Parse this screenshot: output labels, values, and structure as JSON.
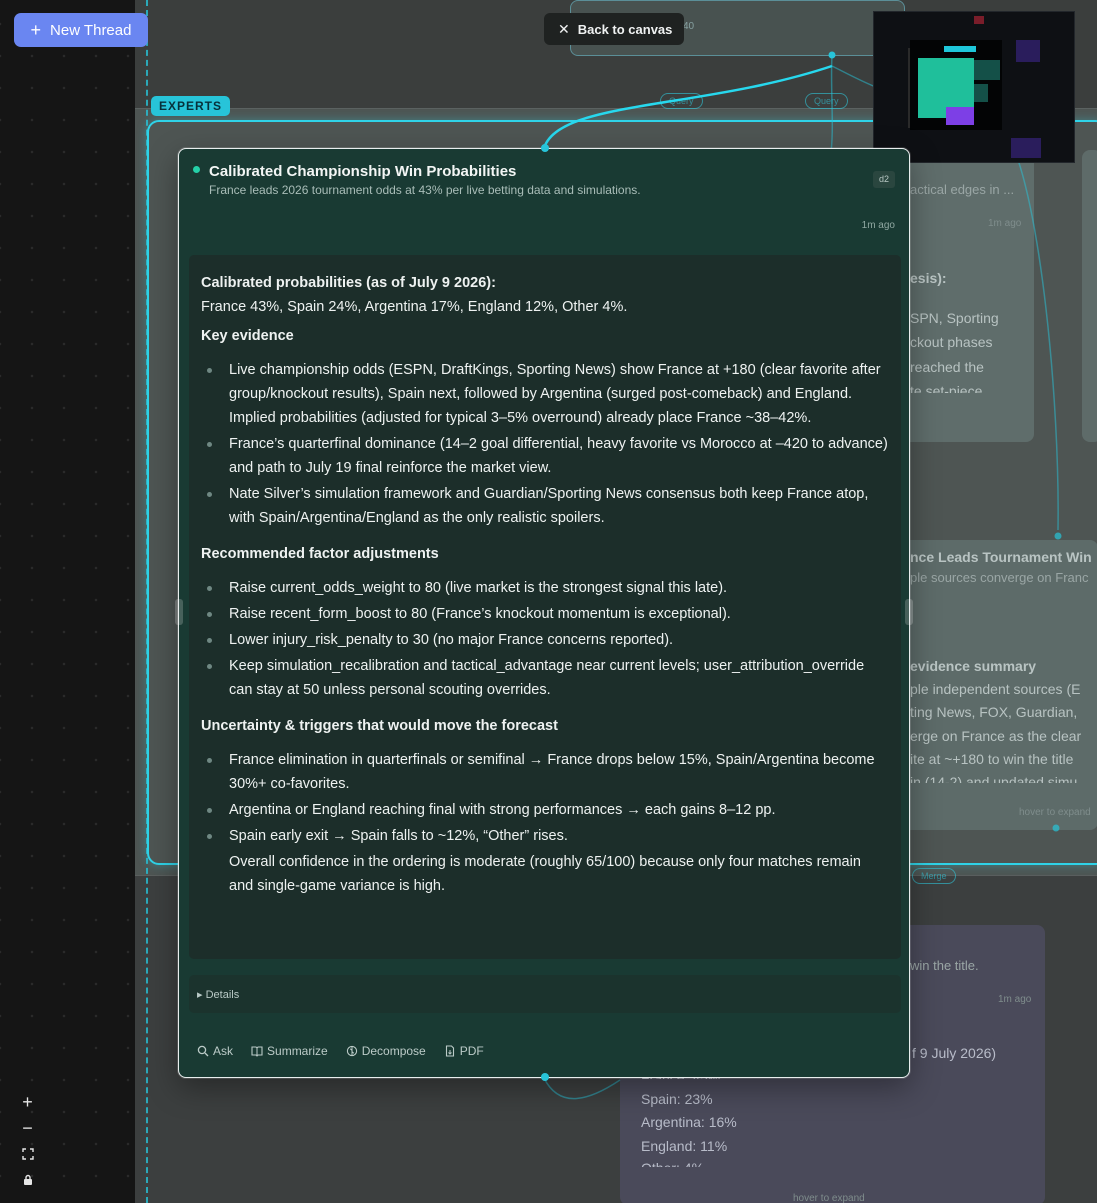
{
  "toolbar": {
    "new_thread_label": "New Thread",
    "back_to_canvas_label": "Back to canvas"
  },
  "group": {
    "tag": "EXPERTS"
  },
  "focused_card": {
    "title": "Calibrated Championship Win Probabilities",
    "subtitle": "France leads 2026 tournament odds at 43% per live betting data and simulations.",
    "badge": "d2",
    "time_ago": "1m ago",
    "heading1": "Calibrated probabilities (as of July 9 2026):",
    "probabilities_line": "France 43%, Spain 24%, Argentina 17%, England 12%, Other 4%.",
    "heading2": "Key evidence",
    "evidence": [
      "Live championship odds (ESPN, DraftKings, Sporting News) show France at +180 (clear favorite after group/knockout results), Spain next, followed by Argentina (surged post-comeback) and England. Implied probabilities (adjusted for typical 3–5% overround) already place France ~38–42%.",
      "France’s quarterfinal dominance (14–2 goal differential, heavy favorite vs Morocco at –420 to advance) and path to July 19 final reinforce the market view.",
      "Nate Silver’s simulation framework and Guardian/Sporting News consensus both keep France atop, with Spain/Argentina/England as the only realistic spoilers."
    ],
    "heading3": "Recommended factor adjustments",
    "adjustments": [
      "Raise current_odds_weight to 80 (live market is the strongest signal this late).",
      "Raise recent_form_boost to 80 (France’s knockout momentum is exceptional).",
      "Lower injury_risk_penalty to 30 (no major France concerns reported).",
      "Keep simulation_recalibration and tactical_advantage near current levels; user_attribution_override can stay at 50 unless personal scouting overrides."
    ],
    "heading4": "Uncertainty & triggers that would move the forecast",
    "triggers": [
      "France elimination in quarterfinals or semifinal → France drops below 15%, Spain/Argentina become 30%+ co-favorites.",
      "Argentina or England reaching final with strong performances → each gains 8–12 pp.",
      "Spain early exit → Spain falls to ~12%, “Other” rises."
    ],
    "closing": "Overall confidence in the ordering is moderate (roughly 65/100) because only four matches remain and single-game variance is high.",
    "details_label": "▸ Details",
    "actions": {
      "ask": "Ask",
      "summarize": "Summarize",
      "decompose": "Decompose",
      "pdf": "PDF"
    }
  },
  "background": {
    "top_card_num": "40",
    "query_pill": "Query",
    "merge_pill": "Merge",
    "right1_sub": "actical edges in ...",
    "right1_time": "1m ago",
    "right1_heading": "esis):",
    "right1_lines": [
      "SPN, Sporting",
      "ckout phases",
      "reached the",
      "te set-piece"
    ],
    "right2_title": "nce Leads Tournament Win",
    "right2_sub": "ple sources converge on Franc",
    "right2_heading": "evidence summary",
    "right2_lines": [
      "ple independent sources (E",
      "ting News, FOX, Guardian,",
      "erge on France as the clear",
      "ite at ~+180 to win the title",
      "in (14-2) and updated simu"
    ],
    "right2_hover": "hover to expand",
    "purple_sub": "win the title.",
    "purple_time": "1m ago",
    "purple_heading": "f 9 July 2026)",
    "purple_lines": [
      "France: 45%",
      "Spain: 23%",
      "Argentina: 16%",
      "England: 11%",
      "Other: 4%"
    ],
    "purple_hover": "hover to expand"
  },
  "colors": {
    "accent_cyan": "#27c4d9",
    "new_thread_bg": "#6a86f1",
    "card_bg": "#193a33",
    "status_dot": "#25d0a8"
  },
  "icons": {
    "zoom_in": "plus-icon",
    "zoom_out": "minus-icon",
    "fit": "fit-view-icon",
    "lock": "lock-icon"
  }
}
